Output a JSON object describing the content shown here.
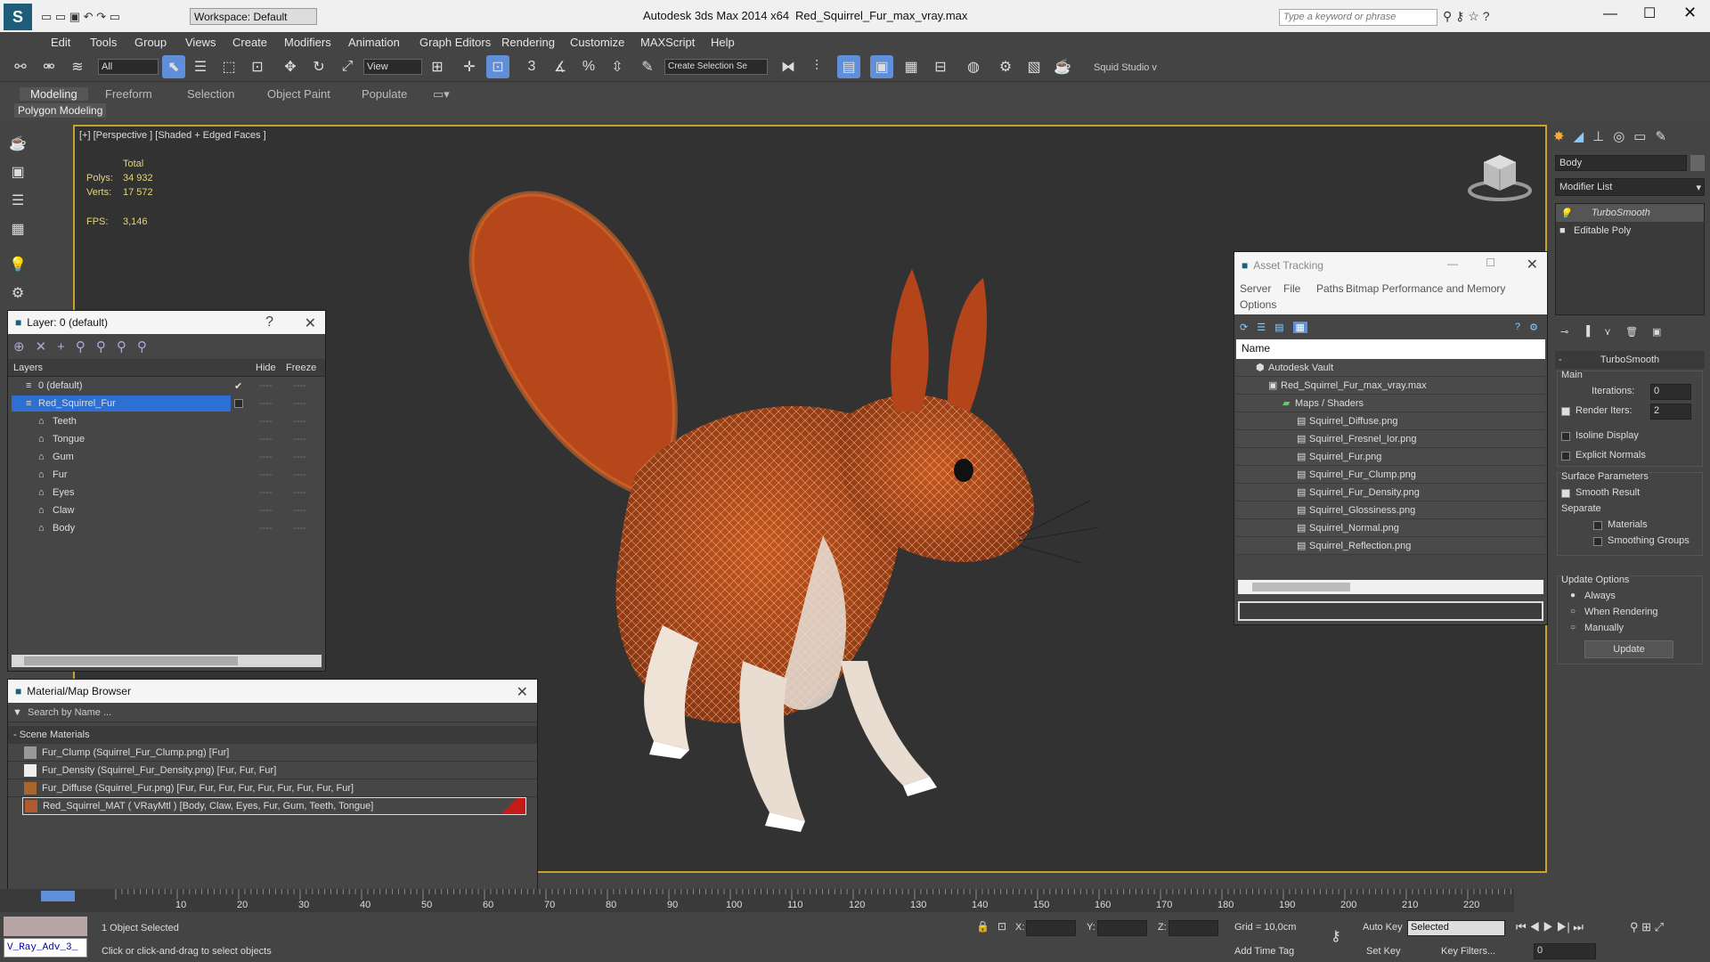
{
  "app": {
    "title": "Autodesk 3ds Max  2014 x64",
    "file": "Red_Squirrel_Fur_max_vray.max",
    "workspace": "Workspace: Default",
    "search_placeholder": "Type a keyword or phrase"
  },
  "menu": [
    "Edit",
    "Tools",
    "Group",
    "Views",
    "Create",
    "Modifiers",
    "Animation",
    "Graph Editors",
    "Rendering",
    "Customize",
    "MAXScript",
    "Help"
  ],
  "toolbar": {
    "filter": "All",
    "ref_coord": "View",
    "selection_set": "Create Selection Se",
    "studio": "Squid Studio v"
  },
  "ribbon": {
    "tabs": [
      "Modeling",
      "Freeform",
      "Selection",
      "Object Paint",
      "Populate"
    ],
    "sub": "Polygon Modeling"
  },
  "viewport": {
    "label": "[+] [Perspective ] [Shaded + Edged Faces ]",
    "stats_header": "Total",
    "polys_label": "Polys:",
    "polys": "34 932",
    "verts_label": "Verts:",
    "verts": "17 572",
    "fps_label": "FPS:",
    "fps": "3,146"
  },
  "layer": {
    "title": "Layer: 0 (default)",
    "help": "?",
    "cols": [
      "Layers",
      "Hide",
      "Freeze"
    ],
    "items": [
      "0 (default)",
      "Red_Squirrel_Fur",
      "Teeth",
      "Tongue",
      "Gum",
      "Fur",
      "Eyes",
      "Claw",
      "Body"
    ]
  },
  "material": {
    "title": "Material/Map Browser",
    "search": "Search by Name ...",
    "section": "- Scene Materials",
    "items": [
      "Fur_Clump (Squirrel_Fur_Clump.png)  [Fur]",
      "Fur_Density (Squirrel_Fur_Density.png)  [Fur, Fur, Fur]",
      "Fur_Diffuse (Squirrel_Fur.png)  [Fur, Fur, Fur, Fur, Fur, Fur, Fur, Fur, Fur]",
      "Red_Squirrel_MAT  ( VRayMtl )  [Body, Claw, Eyes, Fur, Gum, Teeth, Tongue]"
    ]
  },
  "asset": {
    "title": "Asset Tracking",
    "menu": [
      "Server",
      "File",
      "Paths",
      "Bitmap Performance and Memory",
      "Options"
    ],
    "col": "Name",
    "items": [
      "Autodesk Vault",
      "Red_Squirrel_Fur_max_vray.max",
      "Maps / Shaders",
      "Squirrel_Diffuse.png",
      "Squirrel_Fresnel_Ior.png",
      "Squirrel_Fur.png",
      "Squirrel_Fur_Clump.png",
      "Squirrel_Fur_Density.png",
      "Squirrel_Glossiness.png",
      "Squirrel_Normal.png",
      "Squirrel_Reflection.png"
    ]
  },
  "cmd": {
    "object": "Body",
    "modlist": "Modifier List",
    "stack": [
      "TurboSmooth",
      "Editable Poly"
    ],
    "rollout": "TurboSmooth",
    "main": "Main",
    "iter_label": "Iterations:",
    "iter": "0",
    "render_iters": "Render Iters:",
    "render_val": "2",
    "isoline": "Isoline Display",
    "explicit": "Explicit Normals",
    "surface": "Surface Parameters",
    "smooth_result": "Smooth Result",
    "separate": "Separate",
    "materials": "Materials",
    "smoothing": "Smoothing Groups",
    "update_opts": "Update Options",
    "always": "Always",
    "when_rendering": "When Rendering",
    "manually": "Manually",
    "update": "Update"
  },
  "timeline": {
    "ticks": [
      "10",
      "20",
      "30",
      "40",
      "50",
      "60",
      "70",
      "80",
      "90",
      "100",
      "110",
      "120",
      "130",
      "140",
      "150",
      "160",
      "170",
      "180",
      "190",
      "200",
      "210",
      "220"
    ]
  },
  "status": {
    "selected": "1 Object Selected",
    "prompt": "Click or click-and-drag to select objects",
    "x": "X:",
    "y": "Y:",
    "z": "Z:",
    "grid": "Grid = 10,0cm",
    "autokey": "Auto Key",
    "autokey_val": "Selected",
    "setkey": "Set Key",
    "keyfilters": "Key Filters...",
    "addtime": "Add Time Tag",
    "frame": "0",
    "script": "V_Ray_Adv_3_"
  }
}
